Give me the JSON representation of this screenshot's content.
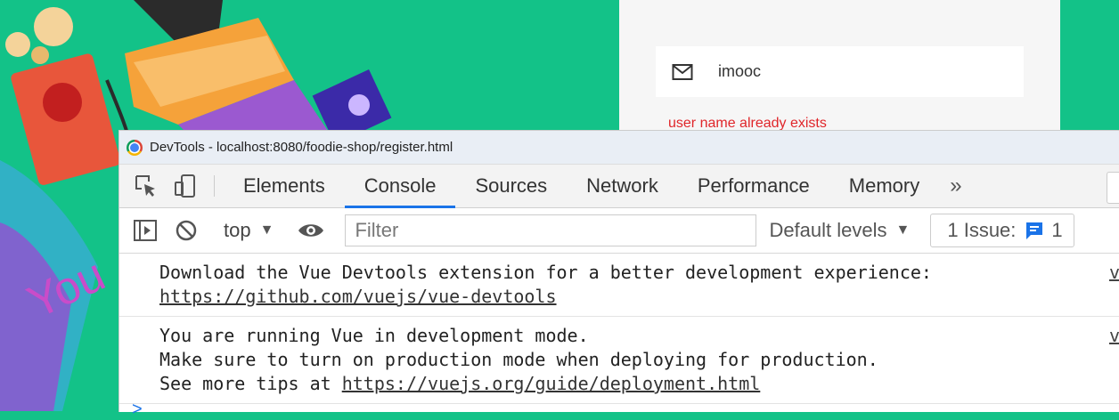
{
  "page": {
    "email_value": "imooc",
    "error_message": "user name already exists"
  },
  "devtools": {
    "title": "DevTools - localhost:8080/foodie-shop/register.html",
    "tabs": [
      "Elements",
      "Console",
      "Sources",
      "Network",
      "Performance",
      "Memory"
    ],
    "active_tab": "Console",
    "more_tabs": "»",
    "toolbar": {
      "context": "top",
      "filter_placeholder": "Filter",
      "levels": "Default levels",
      "issues_label": "1 Issue:",
      "issues_count": "1"
    },
    "messages": [
      {
        "line1": "Download the Vue Devtools extension for a better development experience:",
        "link": "https://github.com/vuejs/vue-devtools",
        "source": "v"
      },
      {
        "line1": "You are running Vue in development mode.",
        "line2": "Make sure to turn on production mode when deploying for production.",
        "prefix": "See more tips at ",
        "link": "https://vuejs.org/guide/deployment.html",
        "source": "v"
      }
    ],
    "prompt": ">"
  },
  "colors": {
    "background": "#13c288",
    "error": "#e0262a",
    "accent": "#1a73e8"
  },
  "icons": [
    "envelope-icon",
    "chrome-logo",
    "inspect-element-icon",
    "device-toggle-icon",
    "sidebar-toggle-icon",
    "clear-console-icon",
    "eye-icon",
    "issue-icon"
  ]
}
